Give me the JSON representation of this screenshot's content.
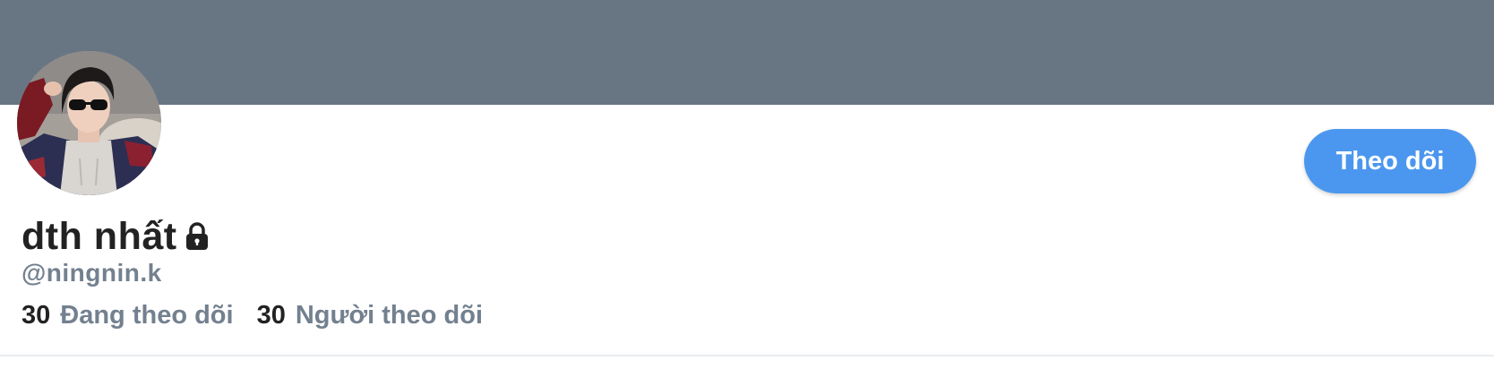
{
  "profile": {
    "banner_color": "#687684",
    "avatar_alt": "Profile photo",
    "display_name": "dth nhất",
    "locked_icon": "lock-icon",
    "handle": "@ningnin.k",
    "follow_button_label": "Theo dõi",
    "accent_color": "#4b97ef",
    "stats": {
      "following": {
        "count": "30",
        "label": "Đang theo dõi"
      },
      "followers": {
        "count": "30",
        "label": "Người theo dõi"
      }
    }
  }
}
